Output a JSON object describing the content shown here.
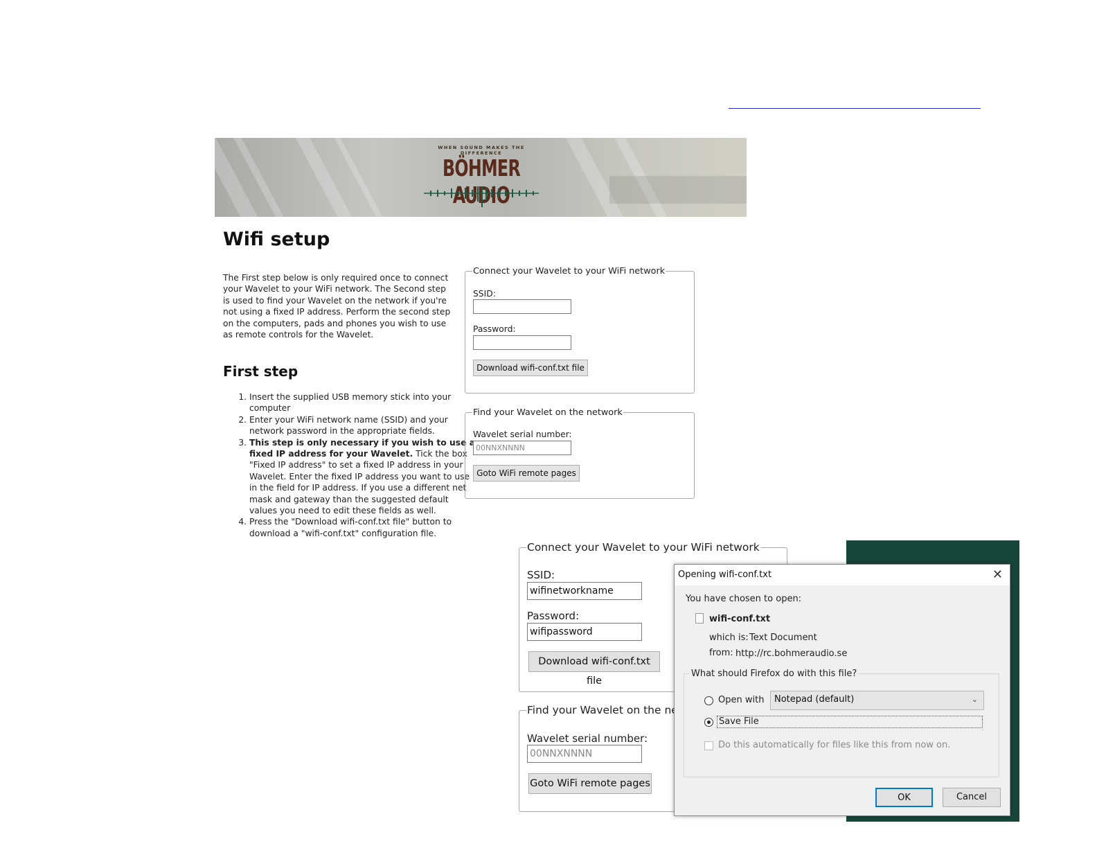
{
  "logo": {
    "tagline": "WHEN SOUND MAKES THE DIFFERENCE",
    "name": "BÖHMER AUDIO"
  },
  "page": {
    "title": "Wifi setup",
    "intro": "The First step below is only required once to connect your Wavelet to your WiFi network. The Second step is used to find your Wavelet on the network if you're not using a fixed IP address. Perform the second step on the computers, pads and phones you wish to use as remote controls for the Wavelet.",
    "first_step_heading": "First step",
    "steps": [
      "Insert the supplied USB memory stick into your computer",
      "Enter your WiFi network name (SSID) and your network password in the appropriate fields.",
      "Press the \"Download wifi-conf.txt file\" button to download a \"wifi-conf.txt\" configuration file."
    ],
    "step3_bold": "This step is only necessary if you wish to use a fixed IP address for your Wavelet.",
    "step3_text": " Tick the box \"Fixed IP address\" to set a fixed IP address in your Wavelet. Enter the fixed IP address you want to use in the field for IP address. If you use a different net mask and gateway than the suggested default values you need to edit these fields as well."
  },
  "connect_panel": {
    "legend": "Connect your Wavelet to your WiFi network",
    "ssid_label": "SSID:",
    "password_label": "Password:",
    "download_button": "Download wifi-conf.txt file"
  },
  "find_panel": {
    "legend": "Find your Wavelet on the network",
    "serial_label": "Wavelet serial number:",
    "serial_placeholder": "00NNXNNNN",
    "goto_button": "Goto WiFi remote pages"
  },
  "zoom": {
    "connect_legend": "Connect your Wavelet to your WiFi network",
    "ssid_label": "SSID:",
    "ssid_value": "wifinetworkname",
    "password_label": "Password:",
    "password_value": "wifipassword",
    "download_button": "Download wifi-conf.txt file",
    "find_legend": "Find your Wavelet on the ne",
    "serial_label": "Wavelet serial number:",
    "serial_placeholder": "00NNXNNNN",
    "goto_button": "Goto WiFi remote pages"
  },
  "dialog": {
    "title": "Opening wifi-conf.txt",
    "chosen_text": "You have chosen to open:",
    "file_name": "wifi-conf.txt",
    "which_is_label": "which is:",
    "which_is_value": "Text Document",
    "from_label": "from:",
    "from_value": "http://rc.bohmeraudio.se",
    "question": "What should Firefox do with this file?",
    "open_with_label": "Open with",
    "open_with_app": "Notepad (default)",
    "save_file_label": "Save File",
    "auto_label": "Do this automatically for files like this from now on.",
    "ok": "OK",
    "cancel": "Cancel",
    "selected_option": "Save File"
  },
  "colors": {
    "logo_brown": "#5a2b1c",
    "wave_green": "#1d5a48",
    "side_green": "#17463b",
    "dialog_focus": "#0078d7"
  }
}
